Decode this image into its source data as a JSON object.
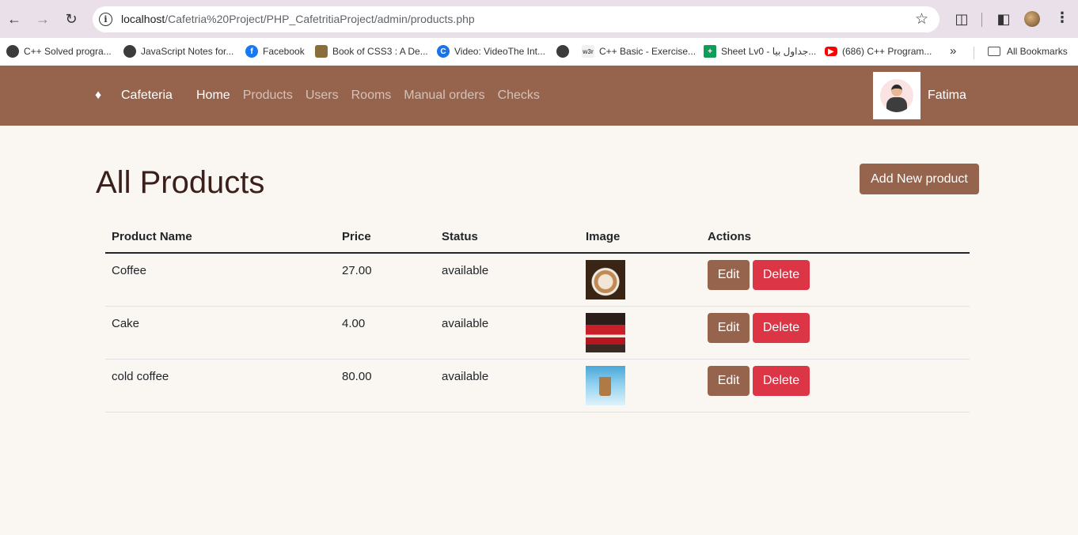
{
  "browser": {
    "url_host": "localhost",
    "url_path": "/Cafetria%20Project/PHP_CafetritiaProject/admin/products.php",
    "bookmarks": [
      {
        "label": "C++ Solved progra...",
        "icon": "globe-icon"
      },
      {
        "label": "JavaScript Notes for...",
        "icon": "globe-icon"
      },
      {
        "label": "Facebook",
        "icon": "facebook-icon"
      },
      {
        "label": "Book of CSS3 : A De...",
        "icon": "book-icon"
      },
      {
        "label": "Video: VideoThe Int...",
        "icon": "c-icon"
      },
      {
        "label": "",
        "icon": "globe-icon"
      },
      {
        "label": "C++ Basic - Exercise...",
        "icon": "w3r-icon"
      },
      {
        "label": "Sheet Lv0 - جداول بيا...",
        "icon": "sheets-icon"
      },
      {
        "label": "(686) C++ Program...",
        "icon": "youtube-icon"
      }
    ],
    "all_bookmarks": "All Bookmarks"
  },
  "navbar": {
    "brand": "Cafeteria",
    "links": [
      "Home",
      "Products",
      "Users",
      "Rooms",
      "Manual orders",
      "Checks"
    ],
    "active": "Home",
    "user_name": "Fatima"
  },
  "main": {
    "title": "All Products",
    "add_button": "Add New product",
    "columns": [
      "Product Name",
      "Price",
      "Status",
      "Image",
      "Actions"
    ],
    "rows": [
      {
        "name": "Coffee",
        "price": "27.00",
        "status": "available",
        "image": "coffee"
      },
      {
        "name": "Cake",
        "price": "4.00",
        "status": "available",
        "image": "cake"
      },
      {
        "name": "cold coffee",
        "price": "80.00",
        "status": "available",
        "image": "cold coffee"
      }
    ],
    "edit_label": "Edit",
    "delete_label": "Delete"
  },
  "colors": {
    "brand": "#96644d",
    "danger": "#dc3545",
    "page_bg": "#faf7f2",
    "title": "#3a1f1a"
  }
}
